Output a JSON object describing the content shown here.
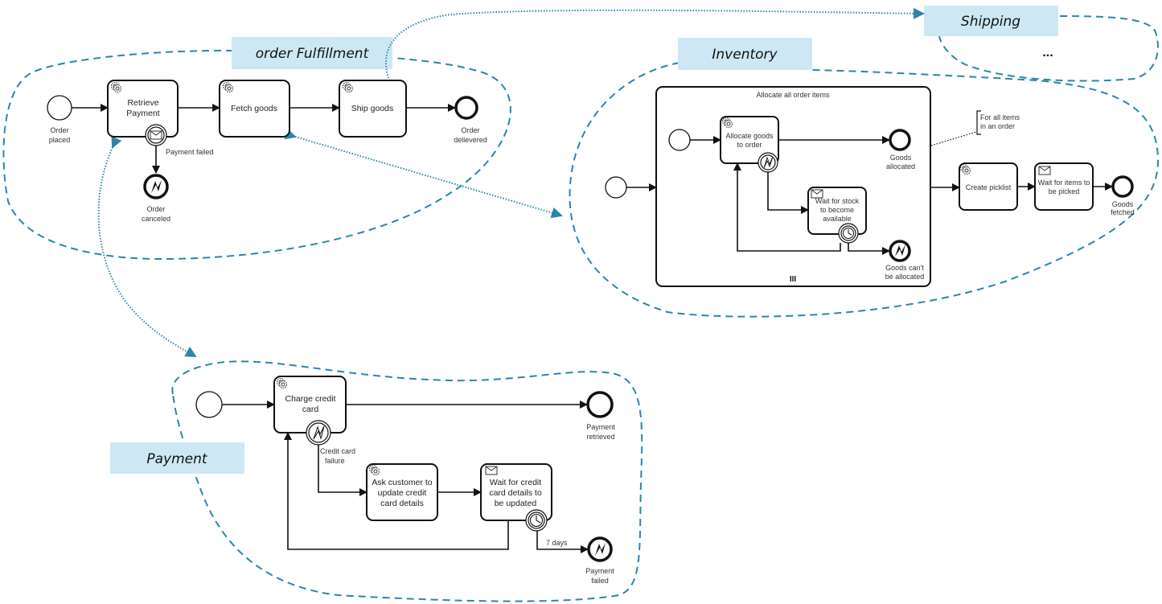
{
  "contexts": {
    "order_fulfillment": "order Fulfillment",
    "inventory": "Inventory",
    "shipping": "Shipping",
    "shipping_ellipsis": "...",
    "payment": "Payment"
  },
  "order_fulfillment": {
    "start_event": [
      "Order",
      "placed"
    ],
    "retrieve_payment": [
      "Retrieve",
      "Payment"
    ],
    "fetch_goods": "Fetch goods",
    "ship_goods": "Ship goods",
    "end_event": [
      "Order",
      "delievered"
    ],
    "boundary_label": "Payment failed",
    "cancel_event": [
      "Order",
      "canceled"
    ]
  },
  "inventory": {
    "subprocess_title": "Allocate all order items",
    "allocate_task": [
      "Allocate goods",
      "to order"
    ],
    "goods_allocated": [
      "Goods",
      "allocated"
    ],
    "wait_stock": [
      "Wait for stock",
      "to become",
      "available"
    ],
    "cant_allocate": [
      "Goods can't",
      "be allocated"
    ],
    "annotation": [
      "For all items",
      "in an order"
    ],
    "create_picklist": "Create picklist",
    "wait_picked": [
      "Wait for items to",
      "be picked"
    ],
    "goods_fetched": [
      "Goods",
      "fetched"
    ],
    "multi_instance_marker": "III"
  },
  "payment": {
    "charge_card": [
      "Charge credit",
      "card"
    ],
    "payment_retrieved": [
      "Payment",
      "retrieved"
    ],
    "card_failure": [
      "Credit card",
      "failure"
    ],
    "ask_customer": [
      "Ask customer to",
      "update credit",
      "card details"
    ],
    "wait_update": [
      "Wait for credit",
      "card details to",
      "be updated"
    ],
    "timer_label": "7 days",
    "payment_failed": [
      "Payment",
      "failed"
    ]
  },
  "colors": {
    "context_border": "#2a86ad",
    "context_label_bg": "#cde8f4"
  }
}
